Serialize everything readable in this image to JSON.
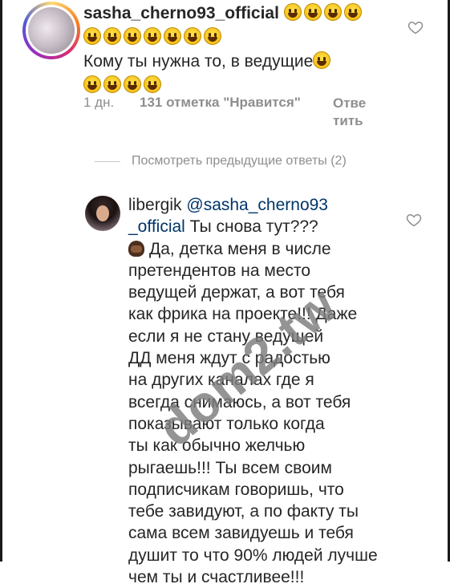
{
  "comment": {
    "username": "sasha_cherno93_official",
    "text": "Кому ты нужна то, в ведущие",
    "emoji_after_username": 11,
    "emoji_after_text": 5,
    "time": "1 дн.",
    "likes": "131 отметка \"Нравится\"",
    "reply_label": "Отве тить"
  },
  "view_previous": "Посмотреть предыдущие ответы (2)",
  "reply": {
    "username": "libergik",
    "mention": "@sasha_cherno93_official",
    "lines": [
      "Ты снова тут???",
      "Да, детка меня в числе",
      "претендентов на место",
      "ведущей держат, а вот тебя",
      "как фрика на проекте!!! Даже",
      "если я не стану ведущей",
      "ДД меня ждут с радостью",
      "на других каналах где я",
      "всегда снимаюсь, а вот тебя",
      "показывают только когда",
      "ты как обычно желчью",
      "рыгаешь!!! Ты всем своим",
      "подписчикам говоришь, что",
      "тебе завидуют, а по факту ты",
      "сама всем завидуешь и тебя",
      "душит то что 90% людей лучше",
      "чем ты и счастливее!!!"
    ]
  },
  "watermark": "dom2.tw",
  "icons": [
    "heart-icon",
    "grinning-emoji",
    "facepalm-emoji"
  ],
  "colors": {
    "text": "#262626",
    "secondary": "#8e8e8e",
    "mention": "#003569"
  }
}
